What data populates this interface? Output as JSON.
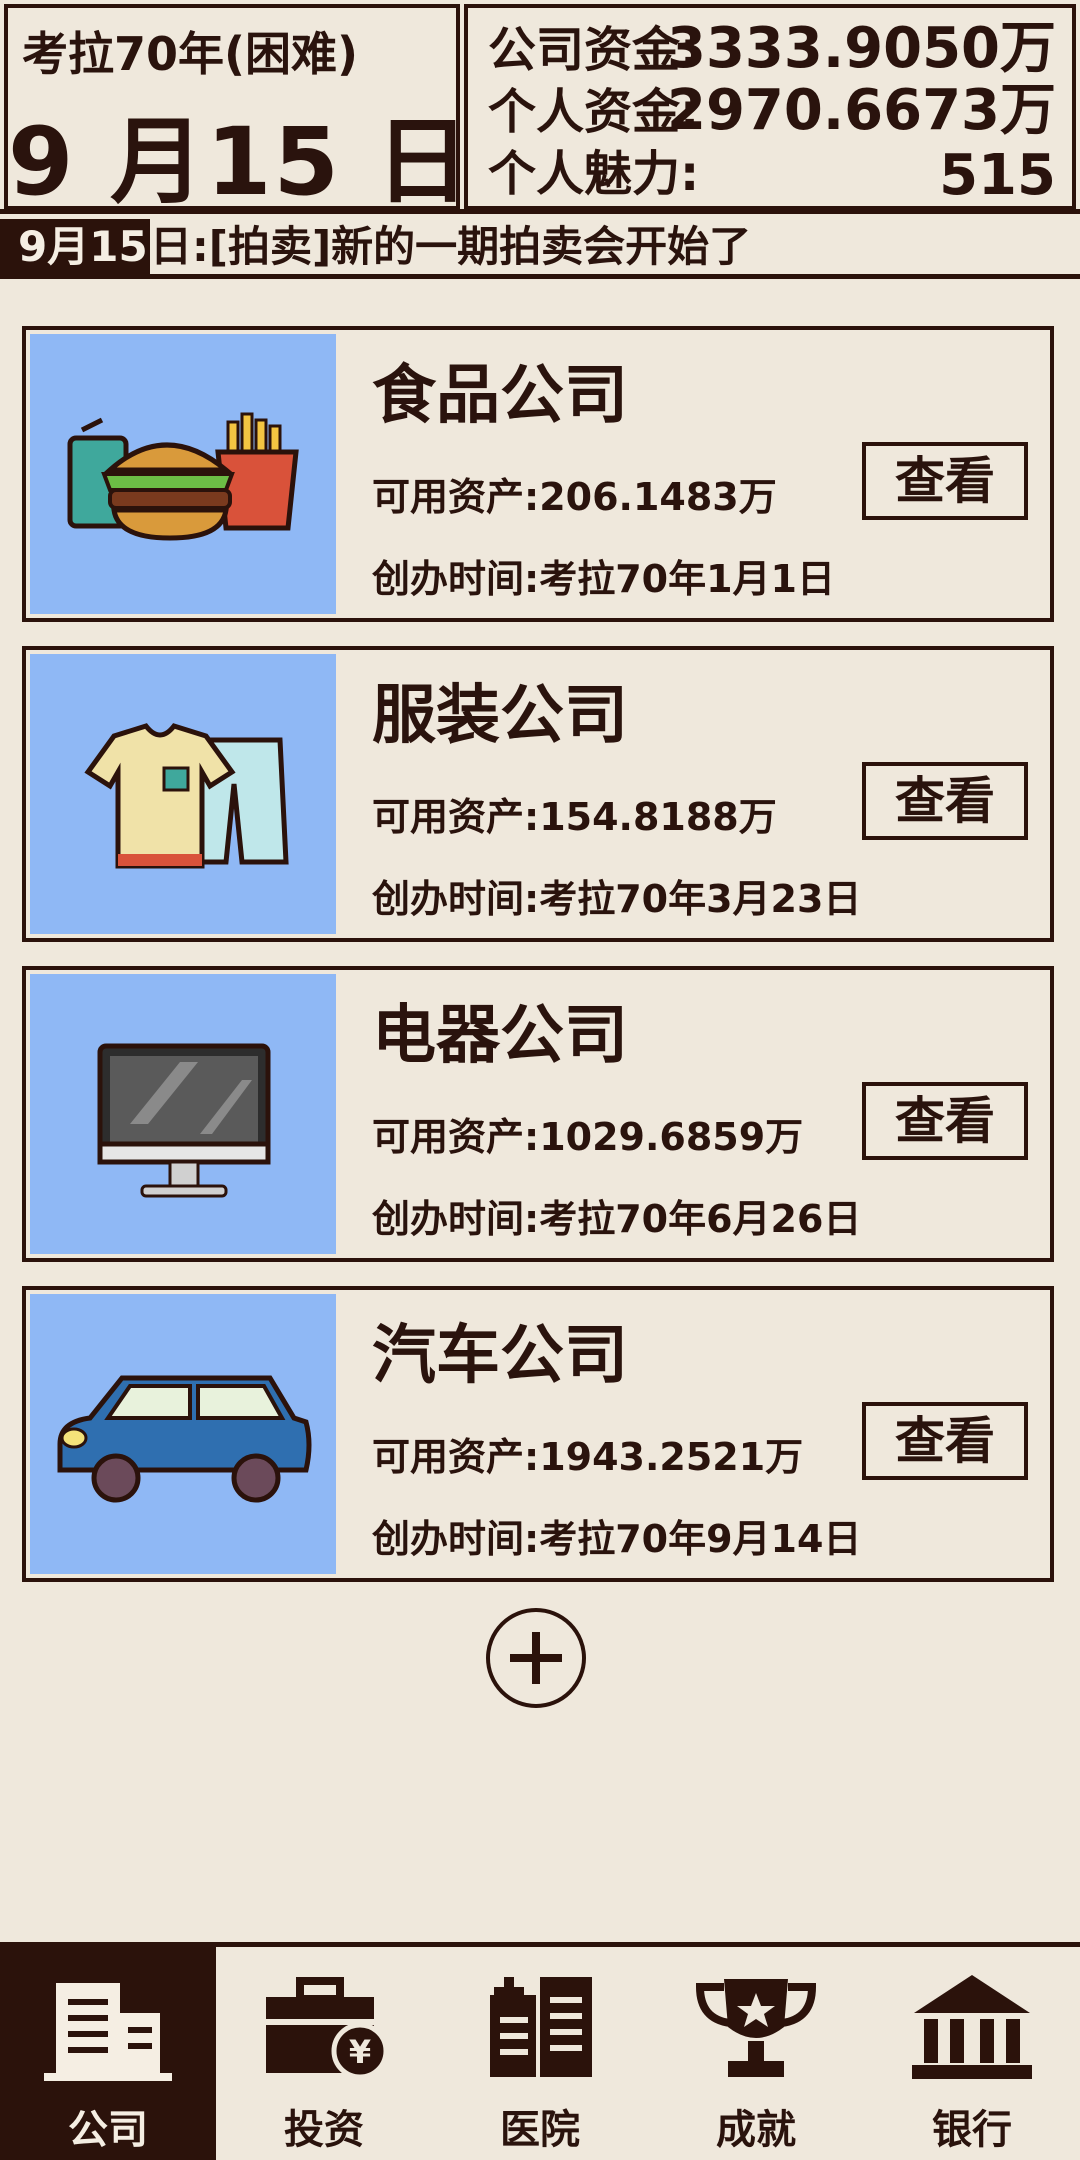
{
  "header": {
    "year_label": "考拉70年(困难)",
    "date": "9 月15 日",
    "stats": [
      {
        "label": "公司资金:",
        "value": "3333.9050万"
      },
      {
        "label": "个人资金:",
        "value": "2970.6673万"
      },
      {
        "label": "个人魅力:",
        "value": "515"
      }
    ]
  },
  "ticker": {
    "date": "9月15",
    "message": "日:[拍卖]新的一期拍卖会开始了"
  },
  "companies": [
    {
      "name": "食品公司",
      "assets": "可用资产:206.1483万",
      "founded": "创办时间:考拉70年1月1日",
      "button": "查看",
      "icon": "food-icon"
    },
    {
      "name": "服装公司",
      "assets": "可用资产:154.8188万",
      "founded": "创办时间:考拉70年3月23日",
      "button": "查看",
      "icon": "clothing-icon"
    },
    {
      "name": "电器公司",
      "assets": "可用资产:1029.6859万",
      "founded": "创办时间:考拉70年6月26日",
      "button": "查看",
      "icon": "computer-icon"
    },
    {
      "name": "汽车公司",
      "assets": "可用资产:1943.2521万",
      "founded": "创办时间:考拉70年9月14日",
      "button": "查看",
      "icon": "car-icon"
    }
  ],
  "add_button": {
    "icon": "plus-icon"
  },
  "nav": [
    {
      "label": "公司",
      "icon": "office-building-icon",
      "active": true
    },
    {
      "label": "投资",
      "icon": "briefcase-yen-icon",
      "active": false
    },
    {
      "label": "医院",
      "icon": "hospital-icon",
      "active": false
    },
    {
      "label": "成就",
      "icon": "trophy-icon",
      "active": false
    },
    {
      "label": "银行",
      "icon": "bank-icon",
      "active": false
    }
  ],
  "colors": {
    "background": "#efe8dc",
    "dark": "#2b120b",
    "card_image_bg": "#8fb8f5"
  }
}
